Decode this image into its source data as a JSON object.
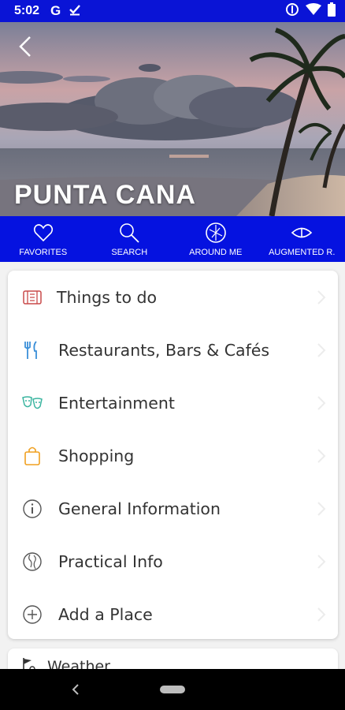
{
  "status_bar": {
    "time": "5:02",
    "google_icon_text": "G",
    "icons": [
      "google-icon",
      "checkmark-icon",
      "data-saver-icon",
      "wifi-icon",
      "battery-icon"
    ]
  },
  "hero": {
    "title": "PUNTA CANA",
    "back_icon": "back-chevron-icon"
  },
  "tabs": [
    {
      "label": "FAVORITES",
      "icon": "heart-icon"
    },
    {
      "label": "SEARCH",
      "icon": "search-icon"
    },
    {
      "label": "AROUND ME",
      "icon": "compass-icon"
    },
    {
      "label": "AUGMENTED R.",
      "icon": "eye-icon"
    }
  ],
  "menu": [
    {
      "label": "Things to do",
      "icon": "ticket-icon",
      "color": "#c94a4a"
    },
    {
      "label": "Restaurants, Bars & Cafés",
      "icon": "fork-knife-icon",
      "color": "#3a8fd8"
    },
    {
      "label": "Entertainment",
      "icon": "theater-masks-icon",
      "color": "#3bb5a0"
    },
    {
      "label": "Shopping",
      "icon": "shopping-bag-icon",
      "color": "#f0a020"
    },
    {
      "label": "General Information",
      "icon": "info-icon",
      "color": "#555555"
    },
    {
      "label": "Practical Info",
      "icon": "globe-icon",
      "color": "#555555"
    },
    {
      "label": "Add a Place",
      "icon": "plus-circle-icon",
      "color": "#555555"
    }
  ],
  "weather": {
    "label": "Weather",
    "icon": "weather-icon"
  },
  "colors": {
    "accent": "#0512e0",
    "status_bar": "#0a14d6"
  }
}
